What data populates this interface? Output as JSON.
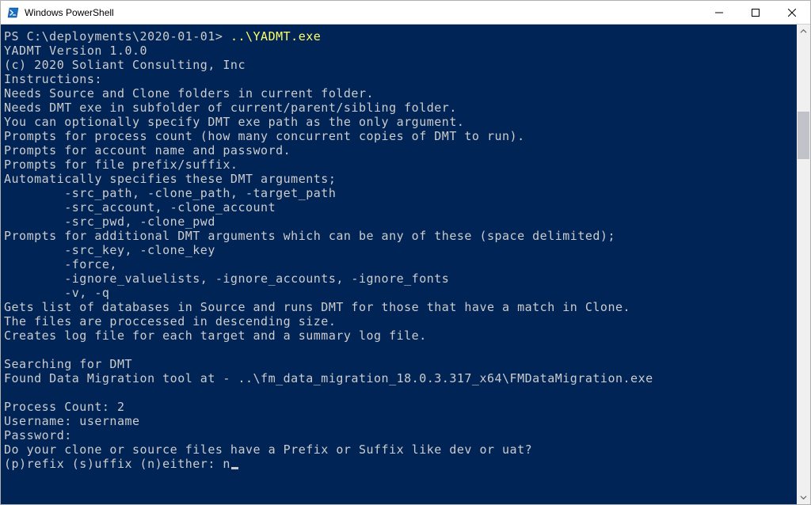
{
  "window": {
    "title": "Windows PowerShell"
  },
  "prompt": {
    "ps": "PS C:\\deployments\\2020-01-01> ",
    "command": "..\\YADMT.exe"
  },
  "output": {
    "lines": [
      "YADMT Version 1.0.0",
      "(c) 2020 Soliant Consulting, Inc",
      "Instructions:",
      "Needs Source and Clone folders in current folder.",
      "Needs DMT exe in subfolder of current/parent/sibling folder.",
      "You can optionally specify DMT exe path as the only argument.",
      "Prompts for process count (how many concurrent copies of DMT to run).",
      "Prompts for account name and password.",
      "Prompts for file prefix/suffix.",
      "Automatically specifies these DMT arguments;",
      "        -src_path, -clone_path, -target_path",
      "        -src_account, -clone_account",
      "        -src_pwd, -clone_pwd",
      "Prompts for additional DMT arguments which can be any of these (space delimited);",
      "        -src_key, -clone_key",
      "        -force,",
      "        -ignore_valuelists, -ignore_accounts, -ignore_fonts",
      "        -v, -q",
      "Gets list of databases in Source and runs DMT for those that have a match in Clone.",
      "The files are proccessed in descending size.",
      "Creates log file for each target and a summary log file.",
      "",
      "Searching for DMT",
      "Found Data Migration tool at - ..\\fm_data_migration_18.0.3.317_x64\\FMDataMigration.exe",
      "",
      "Process Count: 2",
      "Username: username",
      "Password:",
      "Do your clone or source files have a Prefix or Suffix like dev or uat?",
      "(p)refix (s)uffix (n)either: n"
    ]
  }
}
